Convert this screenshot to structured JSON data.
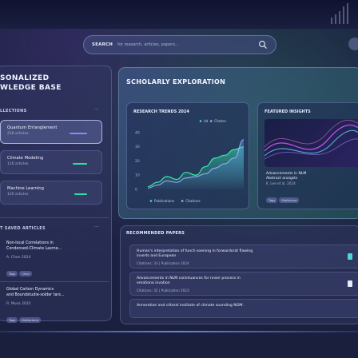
{
  "search": {
    "label": "SEARCH",
    "placeholder": "for research, articles, papers..."
  },
  "left": {
    "title_line1": "SONALIZED",
    "title_line2": "WLEDGE BASE",
    "collections_label": "LLECTIONS",
    "topics": [
      {
        "label": "Quantum Entanglement",
        "sub": "218 articles"
      },
      {
        "label": "Climate Modeling",
        "sub": "116 articles"
      },
      {
        "label": "Machine Learning",
        "sub": "120 articles"
      }
    ],
    "saved_label": "T SAVED ARTICLES",
    "saved": [
      {
        "title1": "Non-local Correlations in",
        "title2": "Condensed-Climate Laxme...",
        "meta": "A. Chen 2024",
        "tags": [
          "Tags",
          "Chen"
        ]
      },
      {
        "title1": "Global Carbon Dynamics",
        "title2": "and Boundstudie-solder tars...",
        "meta": "R. Musa 2022",
        "tags": [
          "Tags",
          "Matterlane"
        ]
      }
    ]
  },
  "main": {
    "title": "SCHOLARLY EXPLORATION",
    "chart_card_title": "RESEARCH TRENDS 2024",
    "insight_title": "FEATURED INSIGHTS",
    "insight_text1": "Advancements in NLM",
    "insight_text2": "Abstract anaigsts",
    "insight_meta": "K. Lee et al. 2024",
    "insight_tags": [
      "Tags",
      "Mattelane"
    ]
  },
  "recommended": {
    "title": "RECOMMENDED PAPERS",
    "papers": [
      {
        "title1": "Human's interpretation of funch soening in forwardorat flawing",
        "title2": "inverts and European",
        "meta": "Citations: 33 | Publication 2024"
      },
      {
        "title1": "Advancements in NLM coninluances for nnser process in",
        "title2": "emationa invation",
        "meta": "Citations: 32 | Publication 2023"
      },
      {
        "title1": "Anneration and clitoral institute of climate sounding NGM:",
        "title2": "",
        "meta": ""
      }
    ]
  },
  "chart_data": {
    "type": "line",
    "title": "RESEARCH TRENDS 2024",
    "y_ticks": [
      "40",
      "30",
      "20",
      "10",
      "0"
    ],
    "ylim": [
      0,
      45
    ],
    "legend_top": [
      "Ad",
      "Citates"
    ],
    "legend_bottom": [
      "Publications",
      "Citations"
    ],
    "series": [
      {
        "name": "Publications",
        "values": [
          2,
          5,
          9,
          7,
          12,
          10,
          16,
          22,
          24,
          28,
          30
        ]
      },
      {
        "name": "Citations",
        "values": [
          1,
          3,
          6,
          5,
          8,
          9,
          11,
          15,
          18,
          22,
          35
        ]
      }
    ]
  }
}
